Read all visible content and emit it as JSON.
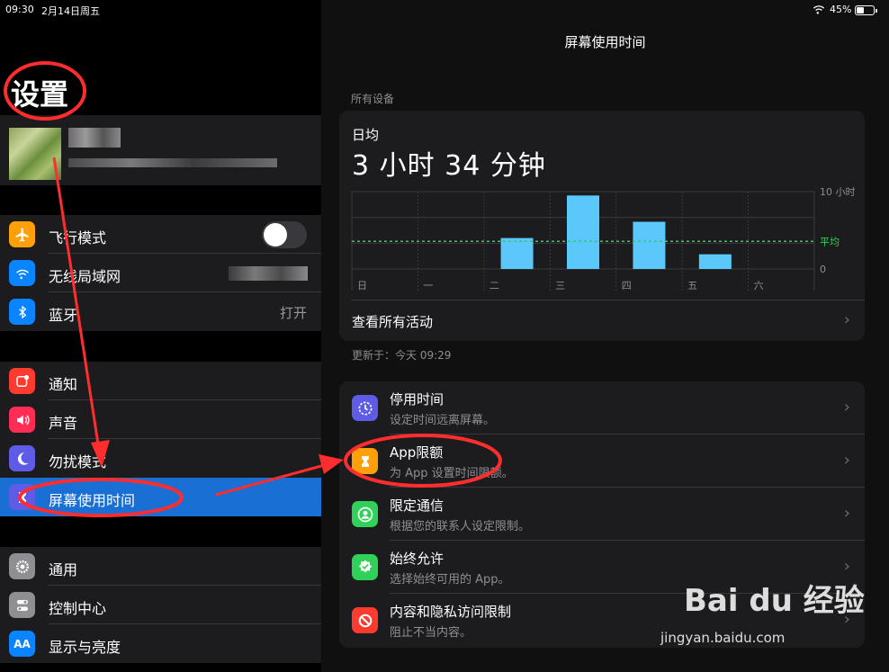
{
  "status": {
    "time": "09:30",
    "date": "2月14日周五",
    "battery": "45%",
    "battery_level": 0.45
  },
  "left": {
    "title": "设置",
    "airplane": {
      "label": "飞行模式",
      "toggle_on": false
    },
    "wifi": {
      "label": "无线局域网"
    },
    "bluetooth": {
      "label": "蓝牙",
      "value": "打开"
    },
    "notifications": {
      "label": "通知"
    },
    "sounds": {
      "label": "声音"
    },
    "dnd": {
      "label": "勿扰模式"
    },
    "screentime": {
      "label": "屏幕使用时间"
    },
    "general": {
      "label": "通用"
    },
    "control_center": {
      "label": "控制中心"
    },
    "display": {
      "label": "显示与亮度"
    },
    "display_icon_text": "AA"
  },
  "right": {
    "title": "屏幕使用时间",
    "section": "所有设备",
    "avg_label": "日均",
    "avg_value": "3 小时 34 分钟",
    "see_all": "查看所有活动",
    "updated": "更新于：今天 09:29",
    "items": [
      {
        "title": "停用时间",
        "subtitle": "设定时间远离屏幕。"
      },
      {
        "title": "App限额",
        "subtitle": "为 App 设置时间限额。"
      },
      {
        "title": "限定通信",
        "subtitle": "根据您的联系人设定限制。"
      },
      {
        "title": "始终允许",
        "subtitle": "选择始终可用的 App。"
      },
      {
        "title": "内容和隐私访问限制",
        "subtitle": "阻止不当内容。"
      }
    ]
  },
  "chart_data": {
    "type": "bar",
    "categories": [
      "日",
      "一",
      "二",
      "三",
      "四",
      "五",
      "六"
    ],
    "values": [
      0,
      0,
      4.0,
      9.5,
      6.1,
      1.9,
      0
    ],
    "ylim": [
      0,
      10
    ],
    "y_tick_labels": [
      "10 小时",
      "0"
    ],
    "average": 3.57,
    "average_label": "平均",
    "bar_color": "#5ac8fa",
    "average_color": "#30d158"
  },
  "watermark": {
    "logo": "Bai du 经验",
    "url": "jingyan.baidu.com"
  },
  "colors": {
    "selection": "#1a6fd4",
    "annotation": "#ff2d2d"
  }
}
